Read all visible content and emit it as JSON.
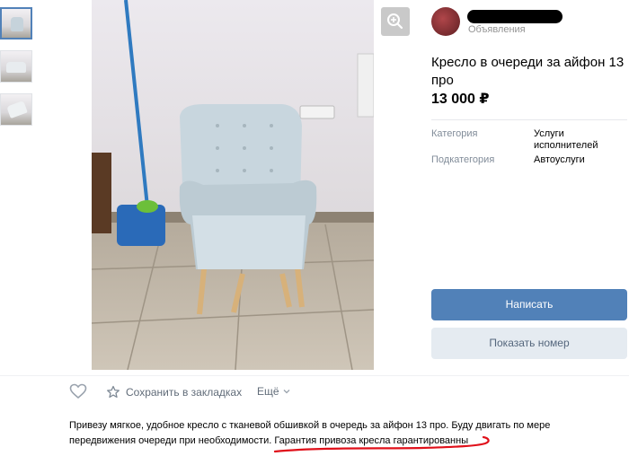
{
  "listing": {
    "title": "Кресло в очереди за айфон 13 про",
    "price": "13 000 ₽",
    "seller_subtitle": "Объявления",
    "properties": [
      {
        "label": "Категория",
        "value": "Услуги исполнителей"
      },
      {
        "label": "Подкатегория",
        "value": "Автоуслуги"
      }
    ],
    "description_part1": "Привезу мягкое, удобное кресло с тканевой обшивкой в очередь за айфон 13 про. Буду двигать по мере передвижения очереди при необходимости. ",
    "description_part2": "Гарантия привоза кресла гарантированны"
  },
  "buttons": {
    "write": "Написать",
    "show_phone": "Показать номер"
  },
  "actions": {
    "save": "Сохранить в закладках",
    "more": "Ещё"
  },
  "colors": {
    "accent": "#5181b8",
    "secondary_button": "#e5ebf1",
    "muted_text": "#818c99",
    "annotation": "#e0101a"
  },
  "icons": [
    "zoom-in-icon",
    "heart-icon",
    "star-icon",
    "chevron-down-icon"
  ]
}
